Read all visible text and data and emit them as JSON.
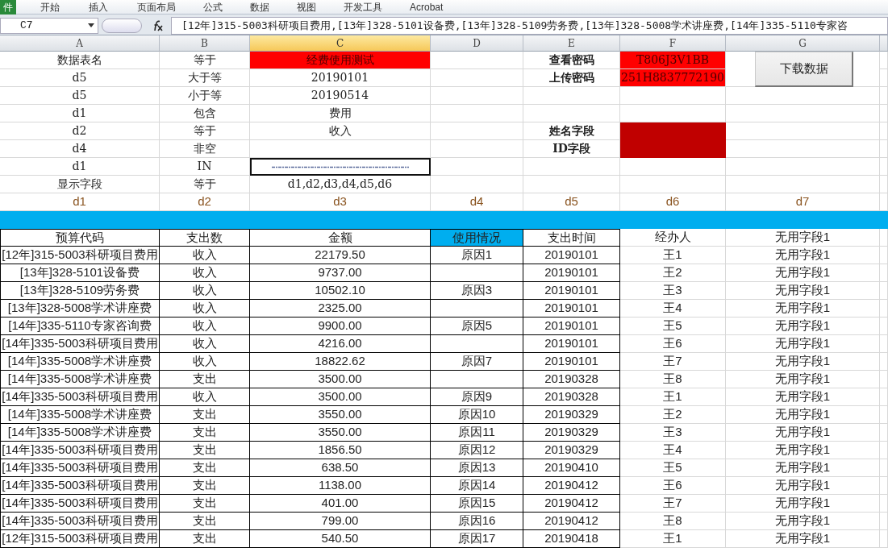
{
  "ribbon": {
    "file_tab": "件",
    "tabs": [
      "开始",
      "插入",
      "页面布局",
      "公式",
      "数据",
      "视图",
      "开发工具",
      "Acrobat"
    ]
  },
  "formula_bar": {
    "name_box": "C7",
    "formula": "[12年]315-5003科研项目费用,[13年]328-5101设备费,[13年]328-5109劳务费,[13年]328-5008学术讲座费,[14年]335-5110专家咨"
  },
  "columns": [
    {
      "label": "A",
      "selected": false
    },
    {
      "label": "B",
      "selected": false
    },
    {
      "label": "C",
      "selected": true
    },
    {
      "label": "D",
      "selected": false
    },
    {
      "label": "E",
      "selected": false
    },
    {
      "label": "F",
      "selected": false
    },
    {
      "label": "G",
      "selected": false
    }
  ],
  "criteria": [
    {
      "field": "数据表名",
      "operator": "等于",
      "value": "经费使用测试",
      "highlighted": true,
      "selected": false
    },
    {
      "field": "d5",
      "operator": "大于等",
      "value": "20190101",
      "highlighted": false,
      "selected": false
    },
    {
      "field": "d5",
      "operator": "小于等",
      "value": "20190514",
      "highlighted": false,
      "selected": false
    },
    {
      "field": "d1",
      "operator": "包含",
      "value": "费用",
      "highlighted": false,
      "selected": false
    },
    {
      "field": "d2",
      "operator": "等于",
      "value": "收入",
      "highlighted": false,
      "selected": false
    },
    {
      "field": "d4",
      "operator": "非空",
      "highlighted": false,
      "selected": false
    },
    {
      "field": "d1",
      "operator": "IN",
      "highlighted": false,
      "selected": true
    },
    {
      "field": "显示字段",
      "operator": "等于",
      "value": "d1,d2,d3,d4,d5,d6",
      "highlighted": false,
      "selected": false
    }
  ],
  "passwords": [
    {
      "label": "查看密码",
      "value": "T806J3V1BB"
    },
    {
      "label": "上传密码",
      "value": "251H8837772190"
    }
  ],
  "field_settings": [
    {
      "label": "姓名字段"
    },
    {
      "label": "ID字段"
    }
  ],
  "download_button": "下载数据",
  "field_codes": [
    "d1",
    "d2",
    "d3",
    "d4",
    "d5",
    "d6",
    "d7"
  ],
  "table": {
    "columns": [
      {
        "label": "预算代码",
        "highlighted": false
      },
      {
        "label": "支出数",
        "highlighted": false
      },
      {
        "label": "金额",
        "highlighted": false
      },
      {
        "label": "使用情况",
        "highlighted": true
      },
      {
        "label": "支出时间",
        "highlighted": false
      },
      {
        "label": "经办人",
        "highlighted": false
      },
      {
        "label": "无用字段1",
        "highlighted": false
      }
    ],
    "rows": [
      [
        "[12年]315-5003科研项目费用",
        "收入",
        "22179.50",
        "原因1",
        "20190101",
        "王1",
        "无用字段1"
      ],
      [
        "[13年]328-5101设备费",
        "收入",
        "9737.00",
        "",
        "20190101",
        "王2",
        "无用字段1"
      ],
      [
        "[13年]328-5109劳务费",
        "收入",
        "10502.10",
        "原因3",
        "20190101",
        "王3",
        "无用字段1"
      ],
      [
        "[13年]328-5008学术讲座费",
        "收入",
        "2325.00",
        "",
        "20190101",
        "王4",
        "无用字段1"
      ],
      [
        "[14年]335-5110专家咨询费",
        "收入",
        "9900.00",
        "原因5",
        "20190101",
        "王5",
        "无用字段1"
      ],
      [
        "[14年]335-5003科研项目费用",
        "收入",
        "4216.00",
        "",
        "20190101",
        "王6",
        "无用字段1"
      ],
      [
        "[14年]335-5008学术讲座费",
        "收入",
        "18822.62",
        "原因7",
        "20190101",
        "王7",
        "无用字段1"
      ],
      [
        "[14年]335-5008学术讲座费",
        "支出",
        "3500.00",
        "",
        "20190328",
        "王8",
        "无用字段1"
      ],
      [
        "[14年]335-5003科研项目费用",
        "收入",
        "3500.00",
        "原因9",
        "20190328",
        "王1",
        "无用字段1"
      ],
      [
        "[14年]335-5008学术讲座费",
        "支出",
        "3550.00",
        "原因10",
        "20190329",
        "王2",
        "无用字段1"
      ],
      [
        "[14年]335-5008学术讲座费",
        "支出",
        "3550.00",
        "原因11",
        "20190329",
        "王3",
        "无用字段1"
      ],
      [
        "[14年]335-5003科研项目费用",
        "支出",
        "1856.50",
        "原因12",
        "20190329",
        "王4",
        "无用字段1"
      ],
      [
        "[14年]335-5003科研项目费用",
        "支出",
        "638.50",
        "原因13",
        "20190410",
        "王5",
        "无用字段1"
      ],
      [
        "[14年]335-5003科研项目费用",
        "支出",
        "1138.00",
        "原因14",
        "20190412",
        "王6",
        "无用字段1"
      ],
      [
        "[14年]335-5003科研项目费用",
        "支出",
        "401.00",
        "原因15",
        "20190412",
        "王7",
        "无用字段1"
      ],
      [
        "[14年]335-5003科研项目费用",
        "支出",
        "799.00",
        "原因16",
        "20190412",
        "王8",
        "无用字段1"
      ],
      [
        "[12年]315-5003科研项目费用",
        "支出",
        "540.50",
        "原因17",
        "20190418",
        "王1",
        "无用字段1"
      ]
    ]
  }
}
